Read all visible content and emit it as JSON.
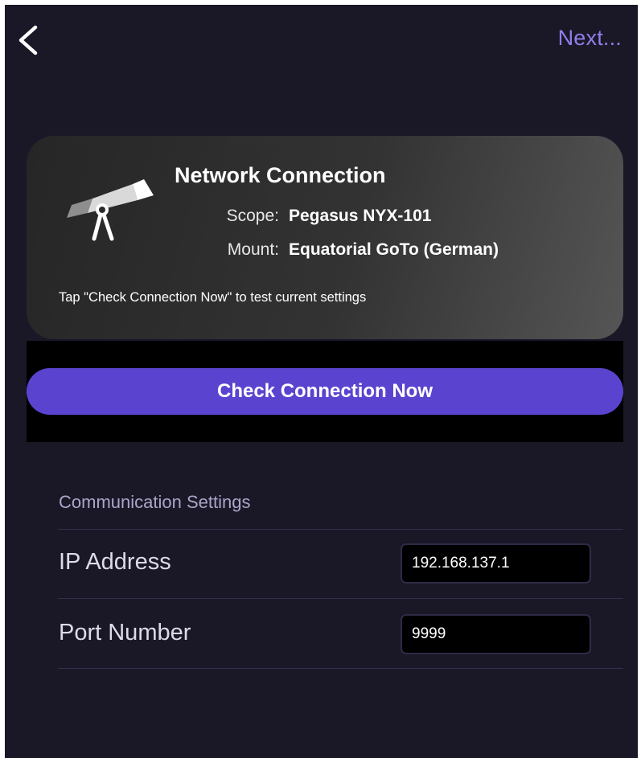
{
  "header": {
    "back_icon": "chevron-left-icon",
    "next_label": "Next..."
  },
  "card": {
    "icon": "telescope-icon",
    "title": "Network Connection",
    "scope_label": "Scope:",
    "scope_value": "Pegasus NYX-101",
    "mount_label": "Mount:",
    "mount_value": "Equatorial GoTo (German)",
    "hint": "Tap \"Check Connection Now\" to test current settings"
  },
  "check_button": {
    "label": "Check Connection Now"
  },
  "settings": {
    "section_title": "Communication Settings",
    "ip_label": "IP Address",
    "ip_value": "192.168.137.1",
    "port_label": "Port Number",
    "port_value": "9999"
  },
  "colors": {
    "background": "#1a1727",
    "accent": "#5a44cf",
    "link": "#8d7fe8"
  }
}
